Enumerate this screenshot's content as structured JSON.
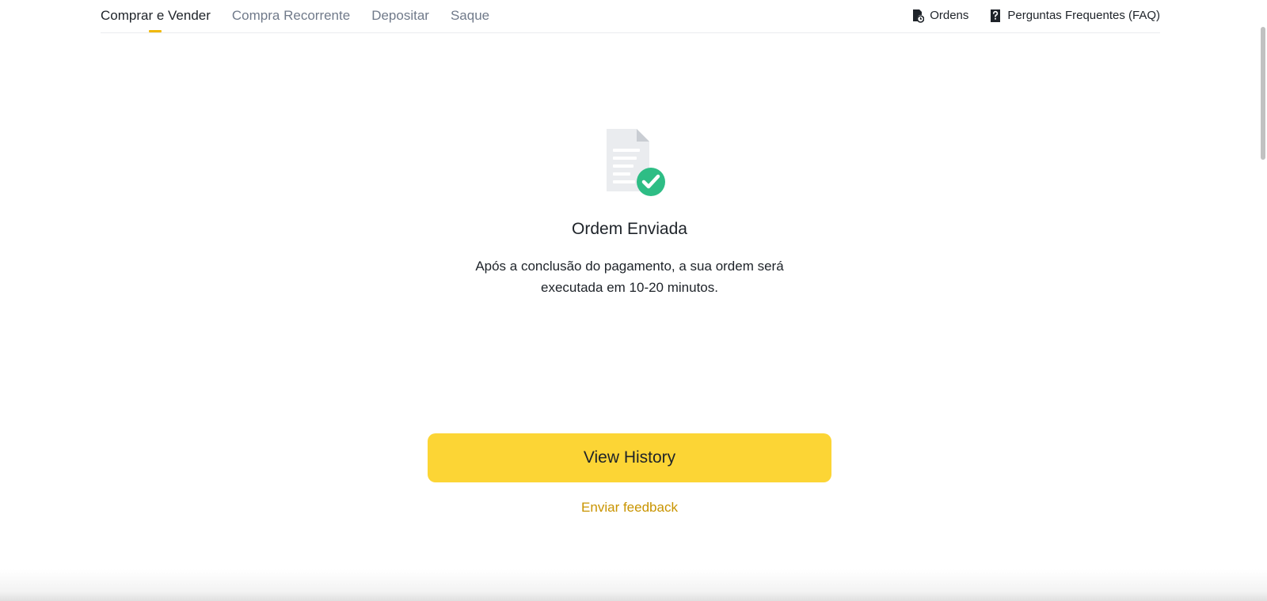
{
  "nav": {
    "tabs": [
      {
        "label": "Comprar e Vender",
        "active": true
      },
      {
        "label": "Compra Recorrente",
        "active": false
      },
      {
        "label": "Depositar",
        "active": false
      },
      {
        "label": "Saque",
        "active": false
      }
    ],
    "right_links": [
      {
        "label": "Ordens",
        "icon": "orders-clock-icon"
      },
      {
        "label": "Perguntas Frequentes (FAQ)",
        "icon": "faq-icon"
      }
    ]
  },
  "result": {
    "illustration_icon": "document-check-icon",
    "title": "Ordem Enviada",
    "message": "Após a conclusão do pagamento, a sua ordem será executada em 10-20 minutos.",
    "primary_button": "View History",
    "feedback_link": "Enviar feedback"
  },
  "colors": {
    "accent": "#fcd535",
    "tab_indicator": "#f0b90b",
    "link": "#c99400",
    "success": "#2ebd85",
    "text_primary": "#1e2329",
    "text_secondary": "#707a8a"
  }
}
